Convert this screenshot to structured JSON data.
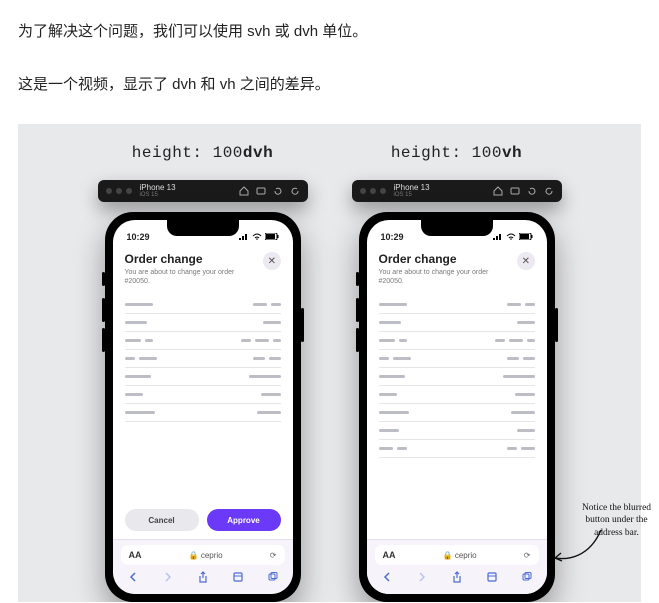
{
  "article": {
    "para1": "为了解决这个问题，我们可以使用 svh 或 dvh 单位。",
    "para2": "这是一个视频，显示了 dvh 和 vh 之间的差异。"
  },
  "figure": {
    "left_label_prefix": "height: 100",
    "left_label_unit": "dvh",
    "right_label_prefix": "height: 100",
    "right_label_unit": "vh",
    "simulator": {
      "device": "iPhone 13",
      "os": "iOS 15"
    },
    "phone": {
      "time": "10:29",
      "sheet_title": "Order change",
      "sheet_subtitle": "You are about to change your order #20050.",
      "cancel": "Cancel",
      "approve": "Approve",
      "address_aA": "AA",
      "address_url": "ceprio",
      "annotation": "Notice the blurred button under the address bar."
    }
  }
}
